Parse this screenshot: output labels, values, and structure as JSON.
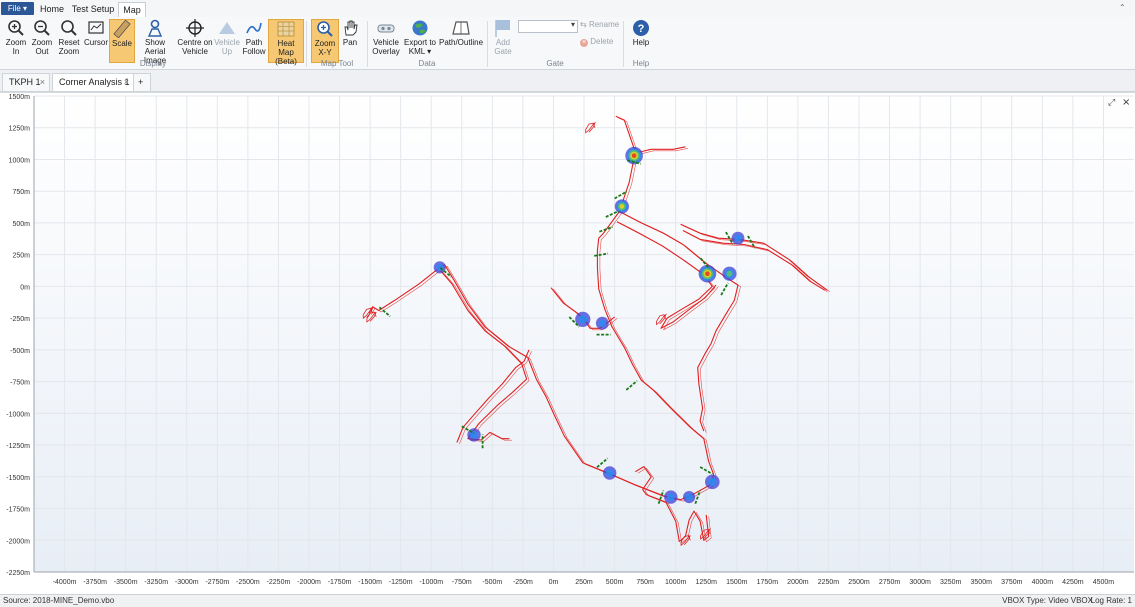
{
  "menubar": {
    "file_label": "File ▾",
    "tabs": [
      "Home",
      "Test Setup",
      "Map"
    ]
  },
  "ribbon": {
    "buttons": {
      "zoom_in": "Zoom In",
      "zoom_out": "Zoom Out",
      "reset_zoom": "Reset Zoom",
      "cursor": "Cursor",
      "scale": "Scale",
      "show_aerial": "Show Aerial Image",
      "centre_on_vehicle": "Centre on Vehicle",
      "vehicle_up": "Vehicle Up",
      "path_follow": "Path Follow",
      "heat_map": "Heat Map (Beta)",
      "zoom_xy": "Zoom X-Y",
      "pan": "Pan",
      "vehicle_overlay": "Vehicle Overlay",
      "export_kml": "Export to KML ▾",
      "path_outline": "Path/Outline",
      "add_gate": "Add Gate",
      "rename": "Rename",
      "delete": "Delete",
      "help": "Help"
    },
    "groups": {
      "display": "Display",
      "map_tool": "Map Tool",
      "data": "Data",
      "gate": "Gate",
      "help": "Help"
    }
  },
  "doc_tabs": [
    "TKPH 1",
    "Corner Analysis 1",
    "+"
  ],
  "chart_data": {
    "type": "scatter",
    "title": "",
    "xlabel": "",
    "ylabel": "",
    "xlim": [
      -4250,
      4750
    ],
    "ylim": [
      -2250,
      1500
    ],
    "x_ticks": [
      -4000,
      -3750,
      -3500,
      -3250,
      -3000,
      -2750,
      -2500,
      -2250,
      -2000,
      -1750,
      -1500,
      -1250,
      -1000,
      -750,
      -500,
      -250,
      0,
      250,
      500,
      750,
      1000,
      1250,
      1500,
      1750,
      2000,
      2250,
      2500,
      2750,
      3000,
      3250,
      3500,
      3750,
      4000,
      4250,
      4500
    ],
    "y_ticks": [
      1500,
      1250,
      1000,
      750,
      500,
      250,
      0,
      -250,
      -500,
      -750,
      -1000,
      -1250,
      -1500,
      -1750,
      -2000,
      -2250
    ],
    "tick_suffix": "m",
    "grid": true,
    "path_color": "#e02020",
    "gate_color": "#1a7a1a",
    "heat_colors": [
      "#3f3fd6",
      "#2a8cf0",
      "#5ec95e",
      "#f0d020",
      "#e83020"
    ],
    "series": [
      {
        "values": [
          [
            -1510,
            -210
          ],
          [
            -1480,
            -160
          ],
          [
            -1430,
            -190
          ],
          [
            -1300,
            -110
          ],
          [
            -1100,
            20
          ],
          [
            -930,
            150
          ],
          [
            -890,
            170
          ],
          [
            -820,
            60
          ],
          [
            -700,
            -140
          ],
          [
            -560,
            -320
          ],
          [
            -470,
            -390
          ],
          [
            -370,
            -470
          ],
          [
            -210,
            -560
          ],
          [
            -140,
            -730
          ],
          [
            -60,
            -870
          ],
          [
            10,
            -1020
          ],
          [
            90,
            -1180
          ],
          [
            240,
            -1390
          ],
          [
            470,
            -1480
          ],
          [
            660,
            -1560
          ],
          [
            900,
            -1650
          ],
          [
            1040,
            -1680
          ],
          [
            1120,
            -1650
          ],
          [
            1290,
            -1560
          ],
          [
            1310,
            -1480
          ],
          [
            1270,
            -1380
          ],
          [
            1230,
            -1200
          ],
          [
            1120,
            -1110
          ],
          [
            950,
            -950
          ],
          [
            820,
            -820
          ],
          [
            720,
            -740
          ],
          [
            650,
            -620
          ],
          [
            580,
            -480
          ],
          [
            480,
            -320
          ],
          [
            420,
            -180
          ],
          [
            370,
            -20
          ],
          [
            360,
            150
          ],
          [
            360,
            280
          ],
          [
            370,
            380
          ],
          [
            410,
            420
          ],
          [
            540,
            590
          ],
          [
            620,
            820
          ],
          [
            670,
            1060
          ],
          [
            580,
            1310
          ],
          [
            510,
            1340
          ]
        ]
      },
      {
        "values": [
          [
            -930,
            130
          ],
          [
            -830,
            20
          ],
          [
            -700,
            -190
          ],
          [
            -560,
            -350
          ],
          [
            -400,
            -470
          ],
          [
            -260,
            -610
          ],
          [
            -220,
            -730
          ],
          [
            -330,
            -830
          ],
          [
            -450,
            -930
          ],
          [
            -610,
            -1080
          ],
          [
            -700,
            -1200
          ],
          [
            -590,
            -1210
          ],
          [
            -520,
            -1150
          ],
          [
            -420,
            -1200
          ],
          [
            -360,
            -1200
          ]
        ]
      },
      {
        "values": [
          [
            -790,
            -1230
          ],
          [
            -740,
            -1110
          ],
          [
            -640,
            -1000
          ],
          [
            -530,
            -880
          ],
          [
            -420,
            -770
          ],
          [
            -310,
            -640
          ],
          [
            -240,
            -590
          ],
          [
            -200,
            -500
          ]
        ]
      },
      {
        "values": [
          [
            540,
            590
          ],
          [
            720,
            500
          ],
          [
            900,
            420
          ],
          [
            1060,
            330
          ],
          [
            1250,
            180
          ],
          [
            1430,
            60
          ],
          [
            1510,
            10
          ],
          [
            1480,
            -110
          ],
          [
            1410,
            -220
          ],
          [
            1330,
            -350
          ],
          [
            1290,
            -450
          ],
          [
            1240,
            -530
          ],
          [
            1180,
            -640
          ],
          [
            1190,
            -770
          ],
          [
            1220,
            -960
          ],
          [
            1200,
            -1060
          ],
          [
            1230,
            -1140
          ]
        ]
      },
      {
        "values": [
          [
            520,
            510
          ],
          [
            700,
            420
          ],
          [
            890,
            320
          ],
          [
            1060,
            210
          ],
          [
            1220,
            100
          ],
          [
            1300,
            0
          ],
          [
            1190,
            -100
          ],
          [
            1050,
            -180
          ],
          [
            930,
            -250
          ],
          [
            880,
            -330
          ],
          [
            980,
            -280
          ],
          [
            1100,
            -190
          ],
          [
            1240,
            -90
          ],
          [
            1330,
            10
          ]
        ]
      },
      {
        "values": [
          [
            1040,
            490
          ],
          [
            1200,
            420
          ],
          [
            1350,
            380
          ],
          [
            1520,
            370
          ],
          [
            1720,
            340
          ],
          [
            1930,
            210
          ],
          [
            2080,
            80
          ],
          [
            2240,
            -30
          ]
        ]
      },
      {
        "values": [
          [
            1060,
            440
          ],
          [
            1200,
            370
          ],
          [
            1390,
            340
          ],
          [
            1560,
            330
          ],
          [
            1750,
            290
          ],
          [
            1950,
            170
          ],
          [
            2100,
            40
          ],
          [
            2220,
            -30
          ]
        ]
      },
      {
        "values": [
          [
            -20,
            -10
          ],
          [
            80,
            -130
          ],
          [
            180,
            -200
          ],
          [
            250,
            -260
          ],
          [
            300,
            -330
          ],
          [
            380,
            -330
          ],
          [
            450,
            -280
          ],
          [
            500,
            -240
          ]
        ]
      },
      {
        "values": [
          [
            670,
            -1460
          ],
          [
            740,
            -1420
          ],
          [
            800,
            -1500
          ],
          [
            730,
            -1600
          ],
          [
            760,
            -1640
          ],
          [
            920,
            -1700
          ],
          [
            1000,
            -1850
          ],
          [
            1030,
            -2010
          ],
          [
            1080,
            -1970
          ],
          [
            1110,
            -1840
          ],
          [
            1150,
            -1770
          ],
          [
            1200,
            -1850
          ],
          [
            1230,
            -2000
          ],
          [
            1270,
            -1970
          ],
          [
            1250,
            -1800
          ]
        ]
      },
      {
        "values": [
          [
            650,
            1100
          ],
          [
            710,
            1060
          ],
          [
            800,
            1080
          ],
          [
            980,
            1080
          ],
          [
            1080,
            1100
          ]
        ]
      }
    ],
    "heat_zones": [
      {
        "x": 660,
        "y": 1030,
        "r": 72,
        "level": 4
      },
      {
        "x": 560,
        "y": 630,
        "r": 58,
        "level": 3
      },
      {
        "x": 1260,
        "y": 100,
        "r": 72,
        "level": 4
      },
      {
        "x": 1440,
        "y": 100,
        "r": 58,
        "level": 2
      },
      {
        "x": 1510,
        "y": 380,
        "r": 52,
        "level": 1
      },
      {
        "x": -930,
        "y": 150,
        "r": 50,
        "level": 1
      },
      {
        "x": 240,
        "y": -260,
        "r": 62,
        "level": 1
      },
      {
        "x": 400,
        "y": -290,
        "r": 52,
        "level": 1
      },
      {
        "x": -650,
        "y": -1170,
        "r": 55,
        "level": 1
      },
      {
        "x": 460,
        "y": -1470,
        "r": 55,
        "level": 1
      },
      {
        "x": 960,
        "y": -1660,
        "r": 55,
        "level": 1
      },
      {
        "x": 1110,
        "y": -1660,
        "r": 50,
        "level": 1
      },
      {
        "x": 1300,
        "y": -1540,
        "r": 60,
        "level": 1
      }
    ],
    "gates": [
      {
        "x": 660,
        "y": 980,
        "angle": -15
      },
      {
        "x": 550,
        "y": 720,
        "angle": 30
      },
      {
        "x": 480,
        "y": 570,
        "angle": 25
      },
      {
        "x": 430,
        "y": 450,
        "angle": 20
      },
      {
        "x": 390,
        "y": 250,
        "angle": 10
      },
      {
        "x": 1440,
        "y": 380,
        "angle": -60
      },
      {
        "x": 1620,
        "y": 350,
        "angle": -60
      },
      {
        "x": 1240,
        "y": 180,
        "angle": -50
      },
      {
        "x": 1400,
        "y": -20,
        "angle": 60
      },
      {
        "x": -1380,
        "y": -200,
        "angle": -40
      },
      {
        "x": -880,
        "y": 110,
        "angle": -40
      },
      {
        "x": 170,
        "y": -280,
        "angle": -45
      },
      {
        "x": 410,
        "y": -380,
        "angle": 0
      },
      {
        "x": 640,
        "y": -780,
        "angle": 40
      },
      {
        "x": -700,
        "y": -1130,
        "angle": -30
      },
      {
        "x": -580,
        "y": -1220,
        "angle": 90
      },
      {
        "x": 400,
        "y": -1390,
        "angle": 40
      },
      {
        "x": 880,
        "y": -1660,
        "angle": 70
      },
      {
        "x": 1180,
        "y": -1660,
        "angle": 70
      },
      {
        "x": 1250,
        "y": -1450,
        "angle": -30
      }
    ]
  },
  "status": {
    "source": "Source: 2018-MINE_Demo.vbo",
    "vbox_type": "VBOX Type: Video VBOX",
    "log_rate": "Log Rate: 1"
  }
}
